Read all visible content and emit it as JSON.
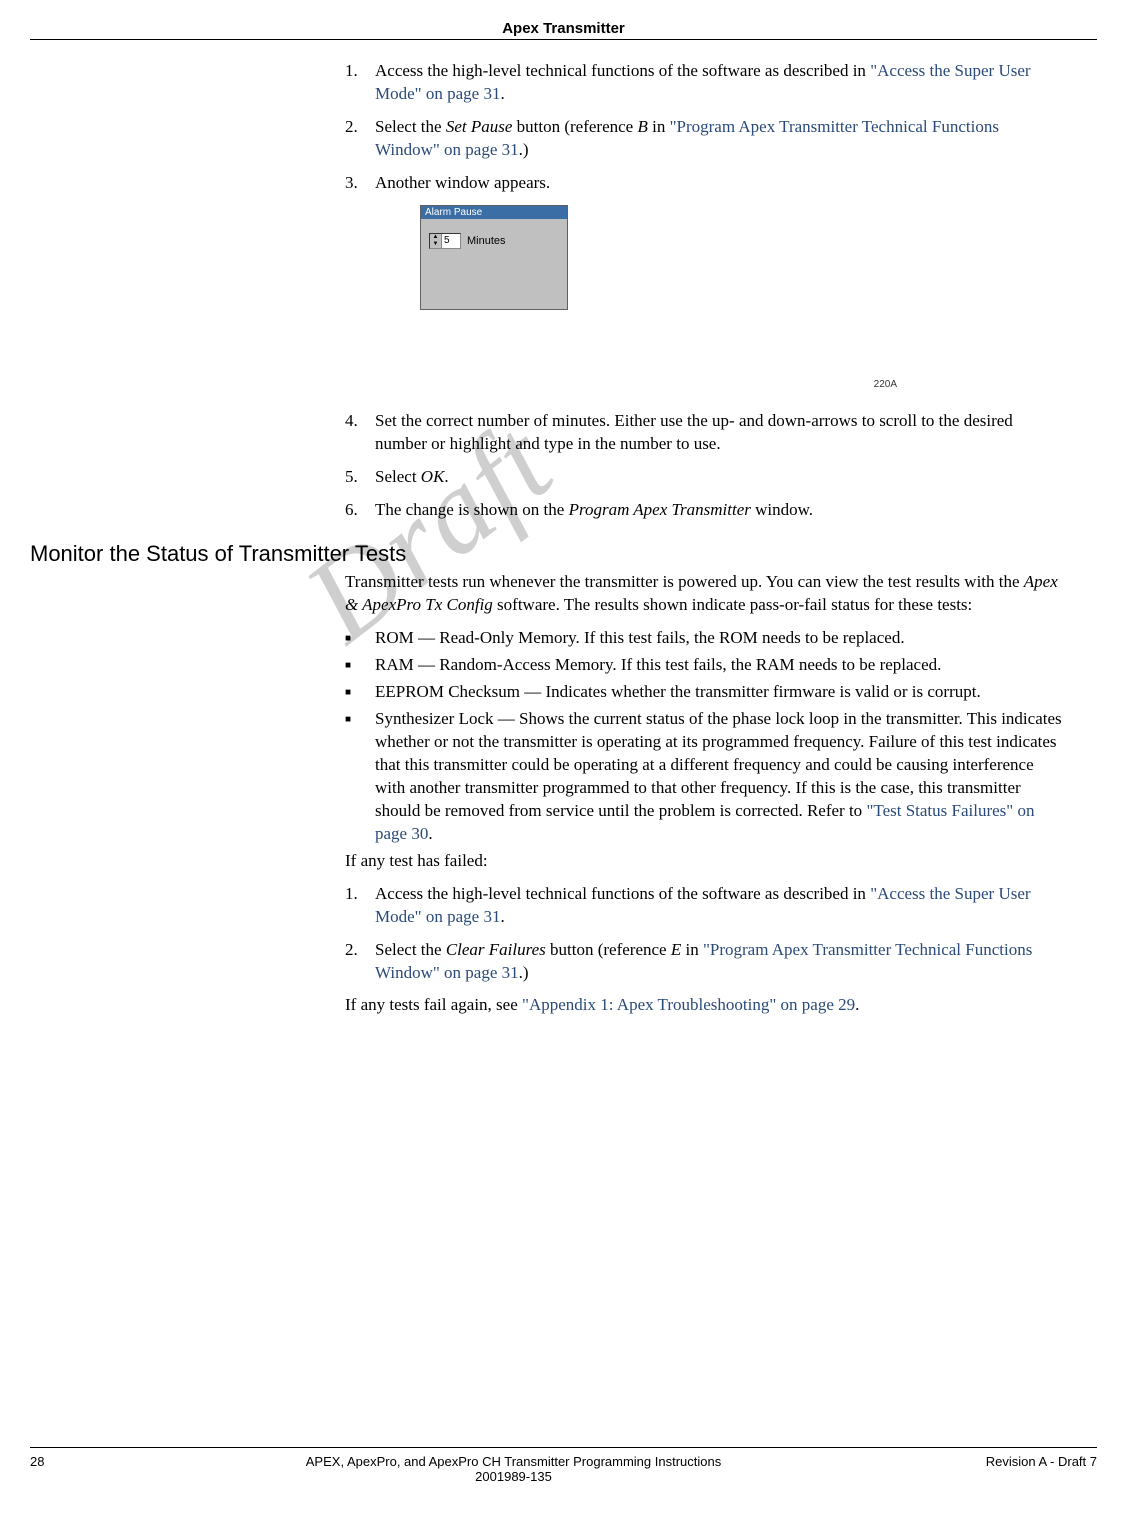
{
  "header": {
    "title": "Apex Transmitter"
  },
  "steps_a": [
    {
      "n": "1.",
      "pre": "Access the high-level technical functions of the software as described in ",
      "xref": "\"Access the Super User Mode\" on page 31",
      "post": "."
    },
    {
      "n": "2.",
      "pre": "Select the ",
      "ital1": "Set Pause",
      "mid1": " button (reference ",
      "ital2": "B",
      "mid2": " in ",
      "xref": "\"Program Apex Transmitter Technical Functions Window\" on page 31",
      "post": ".)"
    },
    {
      "n": "3.",
      "text": "Another window appears."
    }
  ],
  "dialog": {
    "title": "Alarm Pause",
    "value": "5",
    "units": "Minutes"
  },
  "fig_code": "220A",
  "steps_b": [
    {
      "n": "4.",
      "text": "Set the correct number of minutes. Either use the up- and down-arrows to scroll to the desired number or highlight and type in the number to use."
    },
    {
      "n": "5.",
      "pre": "Select ",
      "ital1": "OK",
      "post": "."
    },
    {
      "n": "6.",
      "pre": "The change is shown on the ",
      "ital1": "Program Apex Transmitter",
      "post": " window."
    }
  ],
  "section_heading": "Monitor the Status of Transmitter Tests",
  "intro_para": {
    "pre": "Transmitter tests run whenever the transmitter is powered up. You can view the test results with the ",
    "ital": "Apex & ApexPro Tx Config",
    "post": " software. The results shown indicate pass-or-fail status for these tests:"
  },
  "bullets": [
    {
      "text": "ROM — Read-Only Memory. If this test fails, the ROM needs to be replaced."
    },
    {
      "text": "RAM — Random-Access Memory. If this test fails, the RAM needs to be replaced."
    },
    {
      "text": "EEPROM Checksum — Indicates whether the transmitter firmware is valid or is corrupt."
    },
    {
      "pre": "Synthesizer Lock — Shows the current status of the phase lock loop in the transmitter. This indicates whether or not the transmitter is operating at its programmed frequency. Failure of this test indicates that this transmitter could be operating at a different frequency and could be causing interference with another transmitter programmed to that other frequency. If this is the case, this transmitter should be removed from service until the problem is corrected. Refer to ",
      "xref": "\"Test Status Failures\" on page 30",
      "post": "."
    }
  ],
  "failed_intro": "If any test has failed:",
  "steps_c": [
    {
      "n": "1.",
      "pre": "Access the high-level technical functions of the software as described in ",
      "xref": "\"Access the Super User Mode\" on page 31",
      "post": "."
    },
    {
      "n": "2.",
      "pre": "Select the ",
      "ital1": "Clear Failures",
      "mid1": " button (reference ",
      "ital2": "E",
      "mid2": " in ",
      "xref": "\"Program Apex Transmitter Technical Functions Window\" on page 31",
      "post": ".)"
    }
  ],
  "final_para": {
    "pre": "If any tests fail again, see ",
    "xref": "\"Appendix 1: Apex Troubleshooting\" on page 29",
    "post": "."
  },
  "watermark": "Draft",
  "footer": {
    "page": "28",
    "center1": "APEX, ApexPro, and ApexPro CH Transmitter Programming Instructions",
    "center2": "2001989-135",
    "right": "Revision A - Draft 7"
  }
}
